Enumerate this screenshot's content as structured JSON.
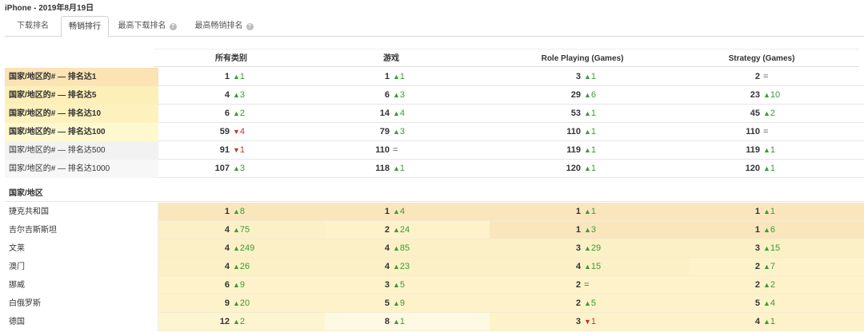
{
  "page_title": "iPhone - 2019年8月19日",
  "tabs": [
    {
      "label": "下载排名",
      "active": false,
      "help": false
    },
    {
      "label": "畅销排行",
      "active": true,
      "help": false
    },
    {
      "label": "最高下载排名",
      "active": false,
      "help": true
    },
    {
      "label": "最高畅销排名",
      "active": false,
      "help": true
    }
  ],
  "columns": [
    "所有类别",
    "游戏",
    "Role Playing (Games)",
    "Strategy (Games)"
  ],
  "summary_rows": [
    {
      "label": "国家/地区的# — 排名达1",
      "bg": "#fce3b4",
      "cells": [
        {
          "n": "1",
          "d": "up",
          "v": "1"
        },
        {
          "n": "1",
          "d": "up",
          "v": "1"
        },
        {
          "n": "3",
          "d": "up",
          "v": "1"
        },
        {
          "n": "2",
          "d": "eq",
          "v": "="
        }
      ]
    },
    {
      "label": "国家/地区的# — 排名达5",
      "bg": "#fdefb8",
      "cells": [
        {
          "n": "4",
          "d": "up",
          "v": "3"
        },
        {
          "n": "6",
          "d": "up",
          "v": "3"
        },
        {
          "n": "29",
          "d": "up",
          "v": "6"
        },
        {
          "n": "23",
          "d": "up",
          "v": "10"
        }
      ]
    },
    {
      "label": "国家/地区的# — 排名达10",
      "bg": "#fdf2be",
      "cells": [
        {
          "n": "6",
          "d": "up",
          "v": "2"
        },
        {
          "n": "14",
          "d": "up",
          "v": "4"
        },
        {
          "n": "53",
          "d": "up",
          "v": "1"
        },
        {
          "n": "45",
          "d": "up",
          "v": "2"
        }
      ]
    },
    {
      "label": "国家/地区的# — 排名达100",
      "bg": "#fef8cf",
      "cells": [
        {
          "n": "59",
          "d": "down",
          "v": "4"
        },
        {
          "n": "79",
          "d": "up",
          "v": "3"
        },
        {
          "n": "110",
          "d": "up",
          "v": "1"
        },
        {
          "n": "110",
          "d": "eq",
          "v": "="
        }
      ]
    },
    {
      "label": "国家/地区的# — 排名达500",
      "bg": "#f2f2f2",
      "cells": [
        {
          "n": "91",
          "d": "down",
          "v": "1"
        },
        {
          "n": "110",
          "d": "eq",
          "v": "="
        },
        {
          "n": "119",
          "d": "up",
          "v": "1"
        },
        {
          "n": "119",
          "d": "up",
          "v": "1"
        }
      ]
    },
    {
      "label": "国家/地区的# — 排名达1000",
      "bg": "#f7f7f7",
      "cells": [
        {
          "n": "107",
          "d": "up",
          "v": "3"
        },
        {
          "n": "118",
          "d": "up",
          "v": "1"
        },
        {
          "n": "120",
          "d": "up",
          "v": "1"
        },
        {
          "n": "120",
          "d": "up",
          "v": "1"
        }
      ]
    }
  ],
  "section_label": "国家/地区",
  "country_rows": [
    {
      "label": "捷克共和国",
      "cells": [
        {
          "n": "1",
          "d": "up",
          "v": "8",
          "bg": "#fae6bd"
        },
        {
          "n": "1",
          "d": "up",
          "v": "4",
          "bg": "#fae6bd"
        },
        {
          "n": "1",
          "d": "up",
          "v": "1",
          "bg": "#fae6bd"
        },
        {
          "n": "1",
          "d": "up",
          "v": "1",
          "bg": "#fae6bd"
        }
      ]
    },
    {
      "label": "吉尔吉斯斯坦",
      "cells": [
        {
          "n": "4",
          "d": "up",
          "v": "75",
          "bg": "#fcf0c6"
        },
        {
          "n": "2",
          "d": "up",
          "v": "24",
          "bg": "#fdf2ca"
        },
        {
          "n": "1",
          "d": "up",
          "v": "3",
          "bg": "#fae6bd"
        },
        {
          "n": "1",
          "d": "up",
          "v": "6",
          "bg": "#fae6bd"
        }
      ]
    },
    {
      "label": "文莱",
      "cells": [
        {
          "n": "4",
          "d": "up",
          "v": "249",
          "bg": "#fcf0c6"
        },
        {
          "n": "4",
          "d": "up",
          "v": "85",
          "bg": "#fcf0c6"
        },
        {
          "n": "3",
          "d": "up",
          "v": "29",
          "bg": "#fcf0c6"
        },
        {
          "n": "3",
          "d": "up",
          "v": "15",
          "bg": "#fcf0c6"
        }
      ]
    },
    {
      "label": "澳门",
      "cells": [
        {
          "n": "4",
          "d": "up",
          "v": "26",
          "bg": "#fcf0c6"
        },
        {
          "n": "4",
          "d": "up",
          "v": "23",
          "bg": "#fcf0c6"
        },
        {
          "n": "4",
          "d": "up",
          "v": "15",
          "bg": "#fcf0c6"
        },
        {
          "n": "2",
          "d": "up",
          "v": "7",
          "bg": "#fdf2ca"
        }
      ]
    },
    {
      "label": "挪威",
      "cells": [
        {
          "n": "6",
          "d": "up",
          "v": "9",
          "bg": "#fdf2ca"
        },
        {
          "n": "3",
          "d": "up",
          "v": "5",
          "bg": "#fdf2ca"
        },
        {
          "n": "2",
          "d": "eq",
          "v": "=",
          "bg": "#fdf2ca"
        },
        {
          "n": "2",
          "d": "up",
          "v": "2",
          "bg": "#fdf2ca"
        }
      ]
    },
    {
      "label": "白俄罗斯",
      "cells": [
        {
          "n": "9",
          "d": "up",
          "v": "20",
          "bg": "#fdf2ca"
        },
        {
          "n": "5",
          "d": "up",
          "v": "9",
          "bg": "#fdf2ca"
        },
        {
          "n": "2",
          "d": "up",
          "v": "5",
          "bg": "#fdf2ca"
        },
        {
          "n": "5",
          "d": "up",
          "v": "4",
          "bg": "#fdf2ca"
        }
      ]
    },
    {
      "label": "德国",
      "cells": [
        {
          "n": "12",
          "d": "up",
          "v": "2",
          "bg": "#fdf4d0"
        },
        {
          "n": "8",
          "d": "up",
          "v": "1",
          "bg": "#fef9e2"
        },
        {
          "n": "3",
          "d": "down",
          "v": "1",
          "bg": "#fdf2ca"
        },
        {
          "n": "4",
          "d": "up",
          "v": "1",
          "bg": "#fdf2ca"
        }
      ]
    }
  ],
  "colors": {
    "up": "#3a9b3a",
    "down": "#c0392b"
  }
}
